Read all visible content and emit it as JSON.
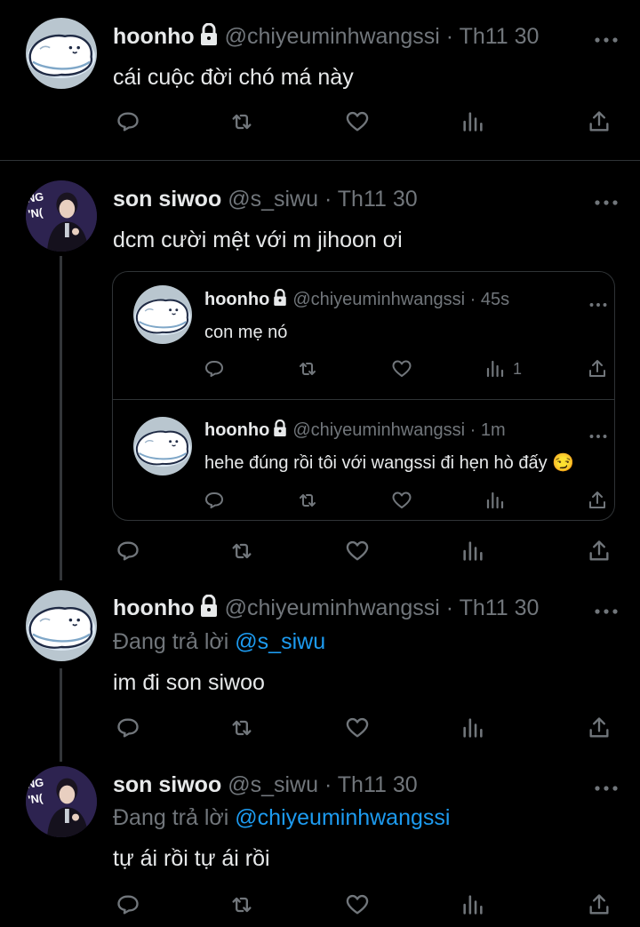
{
  "tweets": [
    {
      "display_name": "hoonho",
      "handle": "@chiyeuminhwangssi",
      "separator": "·",
      "time": "Th11 30",
      "text": "cái cuộc đời chó má này",
      "locked": true
    },
    {
      "display_name": "son siwoo",
      "handle": "@s_siwu",
      "separator": "·",
      "time": "Th11 30",
      "text": "dcm cười mệt với m jihoon ơi",
      "locked": false,
      "quotes": [
        {
          "display_name": "hoonho",
          "handle": "@chiyeuminhwangssi",
          "separator": "·",
          "time": "45s",
          "text": "con mẹ nó",
          "view_count": "1"
        },
        {
          "display_name": "hoonho",
          "handle": "@chiyeuminhwangssi",
          "separator": "·",
          "time": "1m",
          "text": "hehe đúng rồi tôi với wangssi đi hẹn hò đấy 😏"
        }
      ]
    },
    {
      "display_name": "hoonho",
      "handle": "@chiyeuminhwangssi",
      "separator": "·",
      "time": "Th11 30",
      "replying_prefix": "Đang trả lời",
      "replying_to": "@s_siwu",
      "text": "im đi son siwoo",
      "locked": true
    },
    {
      "display_name": "son siwoo",
      "handle": "@s_siwu",
      "separator": "·",
      "time": "Th11 30",
      "replying_prefix": "Đang trả lời",
      "replying_to": "@chiyeuminhwangssi",
      "text": "tự ái rồi tự ái rồi",
      "locked": false
    }
  ],
  "icons": [
    "reply-icon",
    "retweet-icon",
    "like-icon",
    "views-icon",
    "share-icon",
    "more-icon",
    "lock-icon"
  ],
  "colors": {
    "background": "#000000",
    "text": "#e7e9ea",
    "muted": "#71767b",
    "link": "#1d9bf0",
    "divider": "#2f3336"
  }
}
